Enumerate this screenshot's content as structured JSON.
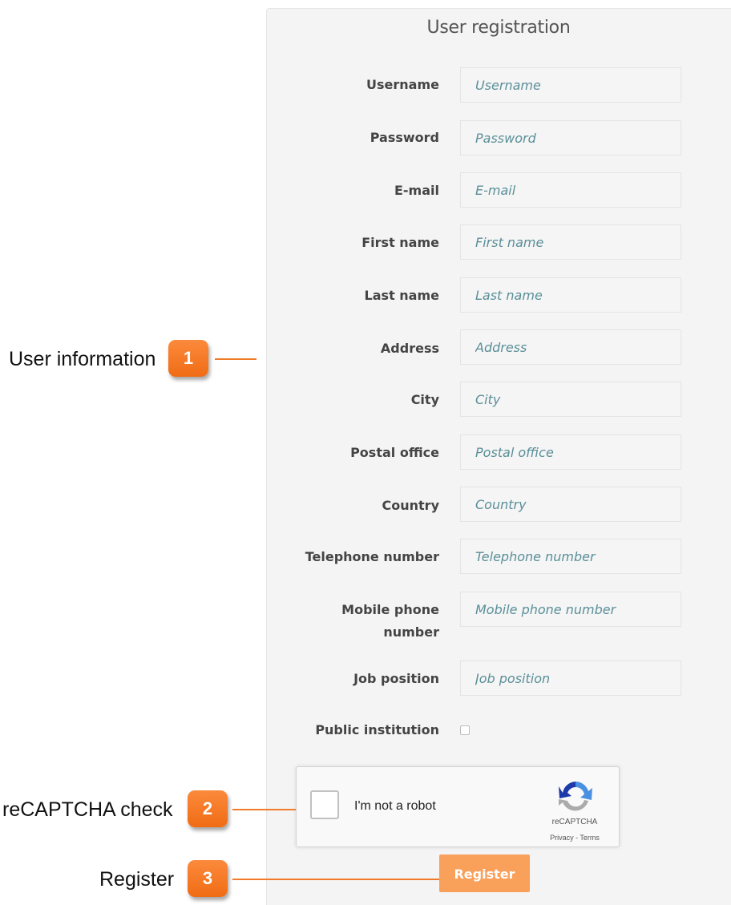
{
  "form": {
    "title": "User registration",
    "fields": [
      {
        "label": "Username",
        "placeholder": "Username"
      },
      {
        "label": "Password",
        "placeholder": "Password"
      },
      {
        "label": "E-mail",
        "placeholder": "E-mail"
      },
      {
        "label": "First name",
        "placeholder": "First name"
      },
      {
        "label": "Last name",
        "placeholder": "Last name"
      },
      {
        "label": "Address",
        "placeholder": "Address"
      },
      {
        "label": "City",
        "placeholder": "City"
      },
      {
        "label": "Postal office",
        "placeholder": "Postal office"
      },
      {
        "label": "Country",
        "placeholder": "Country"
      },
      {
        "label": "Telephone number",
        "placeholder": "Telephone number"
      },
      {
        "label": "Mobile phone number",
        "placeholder": "Mobile phone number"
      },
      {
        "label": "Job position",
        "placeholder": "Job position"
      }
    ],
    "public_institution": {
      "label": "Public institution",
      "checked": false
    },
    "recaptcha": {
      "text": "I'm not a robot",
      "brand": "reCAPTCHA",
      "links": "Privacy - Terms"
    },
    "register_label": "Register"
  },
  "annotations": [
    {
      "number": "1",
      "label": "User information"
    },
    {
      "number": "2",
      "label": "reCAPTCHA check"
    },
    {
      "number": "3",
      "label": "Register"
    }
  ],
  "colors": {
    "accent": "#f9a05a",
    "badge": "#f07b2a",
    "placeholder_text": "#5a8f98",
    "panel_bg": "#f4f4f4"
  }
}
